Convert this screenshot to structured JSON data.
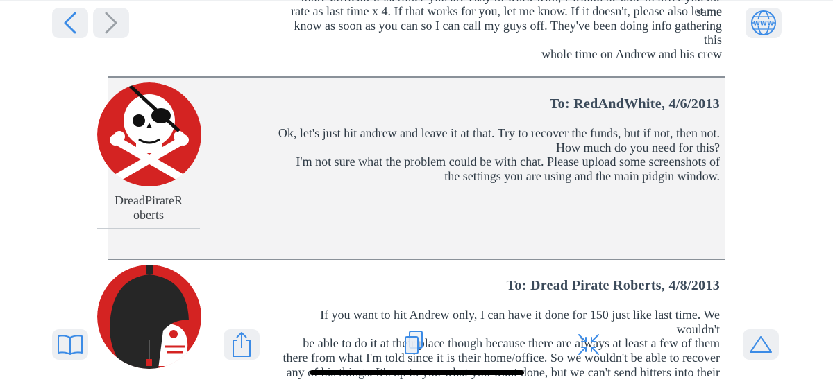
{
  "toolbar": {
    "back_icon": "chevron-left-icon",
    "forward_icon": "chevron-right-icon",
    "web_icon": "globe-www-icon",
    "www_label": "WWW",
    "bookmarks_icon": "book-icon",
    "share_icon": "share-icon",
    "tabs_icon": "tabs-icon",
    "fullscreen_icon": "collapse-arrows-icon",
    "top_icon": "triangle-up-icon",
    "accent_color": "#3b8be6"
  },
  "previous_message": {
    "cut_line": "more difficult it is. Since you are easy to work with, I would be able to offer you the same",
    "lines": [
      "rate as last time x 4. If that works for you, let me know. If it doesn't, please also let me",
      "know as soon as you can so I can call my guys off. They've been doing info gathering this",
      "whole time on Andrew and his crew"
    ]
  },
  "messages": [
    {
      "username_lines": [
        "DreadPirateR",
        "oberts"
      ],
      "header": "To: RedAndWhite, 4/6/2013",
      "lines": [
        "Ok, let's just hit andrew and leave it at that. Try to recover the funds, but if not, then not.",
        "How much do you need for this?",
        "I'm not sure what the problem could be with chat. Please upload some screenshots of",
        "the settings you are using and the main pidgin window."
      ]
    },
    {
      "header": "To: Dread Pirate Roberts, 4/8/2013",
      "lines": [
        "If you want to hit Andrew only, I can have it done for 150 just like last time. We wouldn't",
        "be able to do it at their place though because there are always at least a few of them",
        "there from what I'm told since it is their home/office. So we wouldn't be able to recover",
        "any of his things. It's up to you what you want done, but we can't send hitters into their"
      ]
    }
  ]
}
